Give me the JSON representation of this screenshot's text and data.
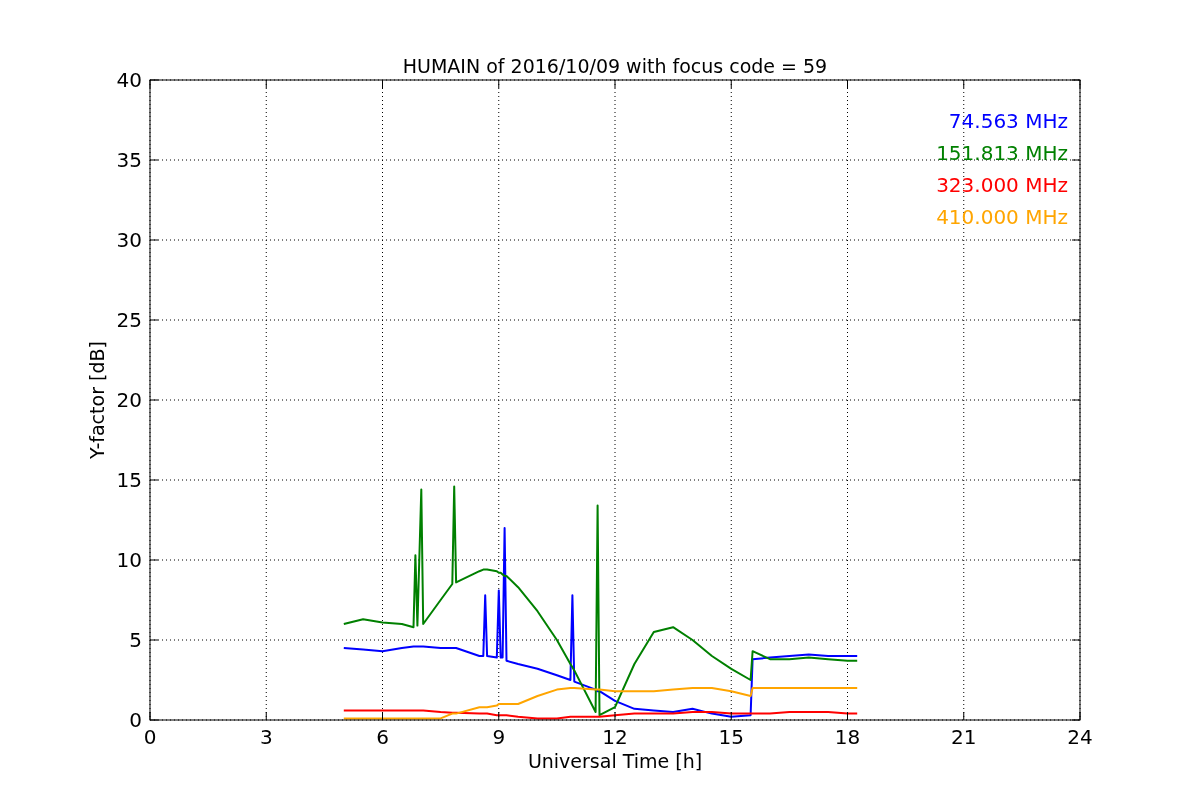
{
  "chart_data": {
    "type": "line",
    "title": "HUMAIN of 2016/10/09 with focus code = 59",
    "xlabel": "Universal Time [h]",
    "ylabel": "Y-factor [dB]",
    "x": [
      5,
      5.5,
      6,
      6.5,
      6.8,
      6.85,
      6.9,
      7,
      7.05,
      7.5,
      7.8,
      7.85,
      7.9,
      8.5,
      8.6,
      8.65,
      8.7,
      8.95,
      9,
      9.05,
      9.1,
      9.15,
      9.2,
      9.5,
      10,
      10.5,
      10.85,
      10.9,
      10.95,
      11.5,
      11.55,
      11.6,
      12,
      12.5,
      13,
      13.5,
      14,
      14.5,
      15,
      15.5,
      15.55,
      16,
      16.5,
      17,
      17.5,
      18,
      18.25
    ],
    "series": [
      {
        "name": "74.563 MHz",
        "color": "#0000ff",
        "values": [
          4.5,
          4.4,
          4.3,
          4.5,
          4.6,
          4.6,
          4.6,
          4.6,
          4.6,
          4.5,
          4.5,
          4.5,
          4.5,
          4.0,
          4.0,
          7.8,
          4.0,
          3.9,
          8.1,
          3.9,
          3.9,
          12.0,
          3.7,
          3.5,
          3.2,
          2.8,
          2.5,
          7.8,
          2.4,
          1.9,
          1.8,
          1.8,
          1.2,
          0.7,
          0.6,
          0.5,
          0.7,
          0.4,
          0.2,
          0.3,
          3.8,
          3.9,
          4.0,
          4.1,
          4.0,
          4.0,
          4.0
        ]
      },
      {
        "name": "151.813 MHz",
        "color": "#008000",
        "values": [
          6.0,
          6.3,
          6.1,
          6.0,
          5.8,
          10.3,
          5.9,
          14.4,
          6.0,
          7.5,
          8.5,
          14.6,
          8.6,
          9.3,
          9.4,
          9.4,
          9.4,
          9.3,
          9.2,
          9.2,
          9.1,
          9.0,
          9.0,
          8.3,
          6.8,
          5.0,
          3.5,
          3.3,
          3.1,
          0.5,
          13.4,
          0.3,
          0.8,
          3.5,
          5.5,
          5.8,
          5.0,
          4.0,
          3.2,
          2.5,
          4.3,
          3.8,
          3.8,
          3.9,
          3.8,
          3.7,
          3.7
        ]
      },
      {
        "name": "323.000 MHz",
        "color": "#ff0000",
        "values": [
          0.6,
          0.6,
          0.6,
          0.6,
          0.6,
          0.6,
          0.6,
          0.6,
          0.6,
          0.5,
          0.45,
          0.45,
          0.45,
          0.4,
          0.4,
          0.4,
          0.4,
          0.3,
          0.3,
          0.3,
          0.3,
          0.3,
          0.3,
          0.2,
          0.1,
          0.1,
          0.2,
          0.2,
          0.2,
          0.2,
          0.2,
          0.2,
          0.3,
          0.4,
          0.4,
          0.4,
          0.5,
          0.5,
          0.4,
          0.4,
          0.4,
          0.4,
          0.5,
          0.5,
          0.5,
          0.4,
          0.4
        ]
      },
      {
        "name": "410.000 MHz",
        "color": "#ffa500",
        "values": [
          0.1,
          0.1,
          0.1,
          0.1,
          0.1,
          0.1,
          0.1,
          0.1,
          0.1,
          0.1,
          0.4,
          0.4,
          0.4,
          0.8,
          0.8,
          0.8,
          0.8,
          0.9,
          1.0,
          1.0,
          1.0,
          1.0,
          1.0,
          1.0,
          1.5,
          1.9,
          2.0,
          2.0,
          2.0,
          1.9,
          1.9,
          1.9,
          1.8,
          1.8,
          1.8,
          1.9,
          2.0,
          2.0,
          1.8,
          1.5,
          2.0,
          2.0,
          2.0,
          2.0,
          2.0,
          2.0,
          2.0
        ]
      }
    ],
    "grid": true,
    "xlim": [
      0,
      24
    ],
    "ylim": [
      0,
      40
    ],
    "xticks": [
      0,
      3,
      6,
      9,
      12,
      15,
      18,
      21,
      24
    ],
    "yticks": [
      0,
      5,
      10,
      15,
      20,
      25,
      30,
      35,
      40
    ]
  }
}
